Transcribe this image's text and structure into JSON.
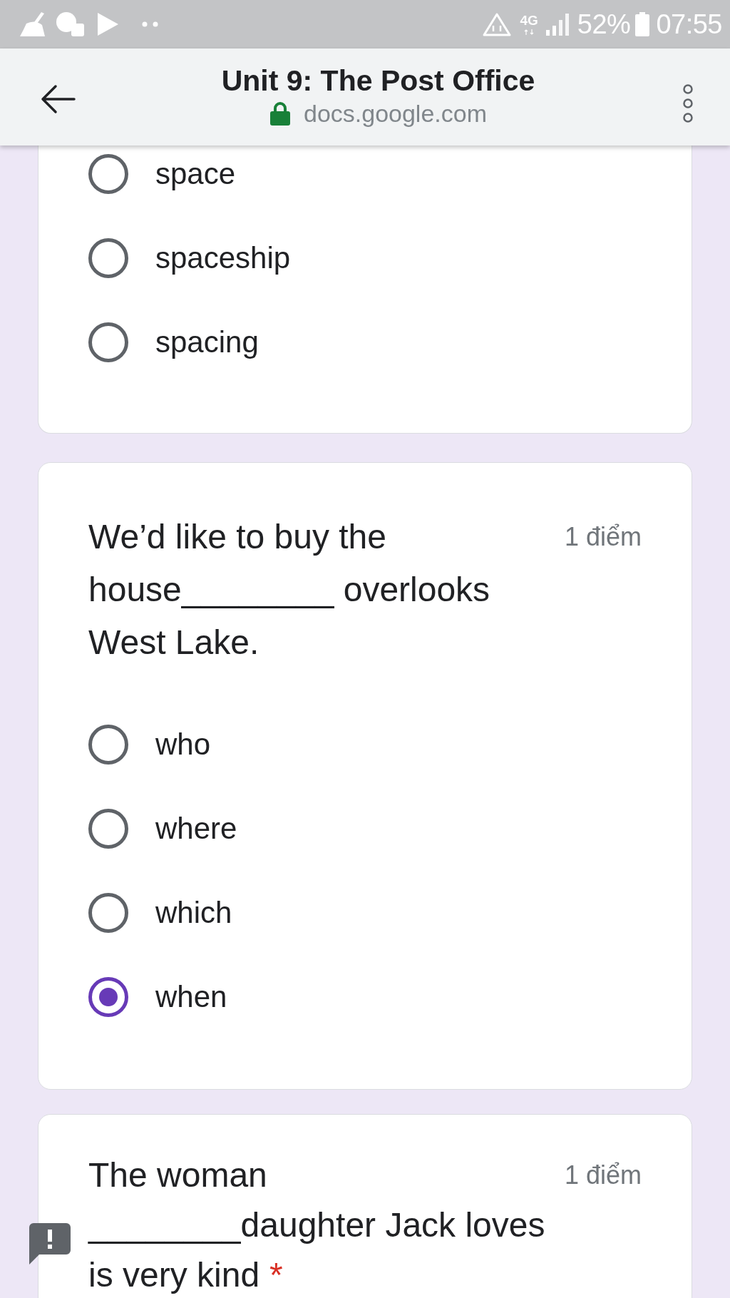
{
  "status_bar": {
    "network": "4G",
    "battery": "52%",
    "time": "07:55"
  },
  "header": {
    "title": "Unit 9: The Post Office",
    "url": "docs.google.com"
  },
  "questions": [
    {
      "options": [
        {
          "label": "space",
          "selected": false
        },
        {
          "label": "spaceship",
          "selected": false
        },
        {
          "label": "spacing",
          "selected": false
        }
      ]
    },
    {
      "text": "We’d like to buy the house________ overlooks West Lake.",
      "points": "1 điểm",
      "options": [
        {
          "label": "who",
          "selected": false
        },
        {
          "label": "where",
          "selected": false
        },
        {
          "label": "which",
          "selected": false
        },
        {
          "label": "when",
          "selected": true
        }
      ]
    },
    {
      "text": "The woman ________daughter Jack loves is very kind",
      "points": "1 điểm",
      "required_mark": "*"
    }
  ]
}
